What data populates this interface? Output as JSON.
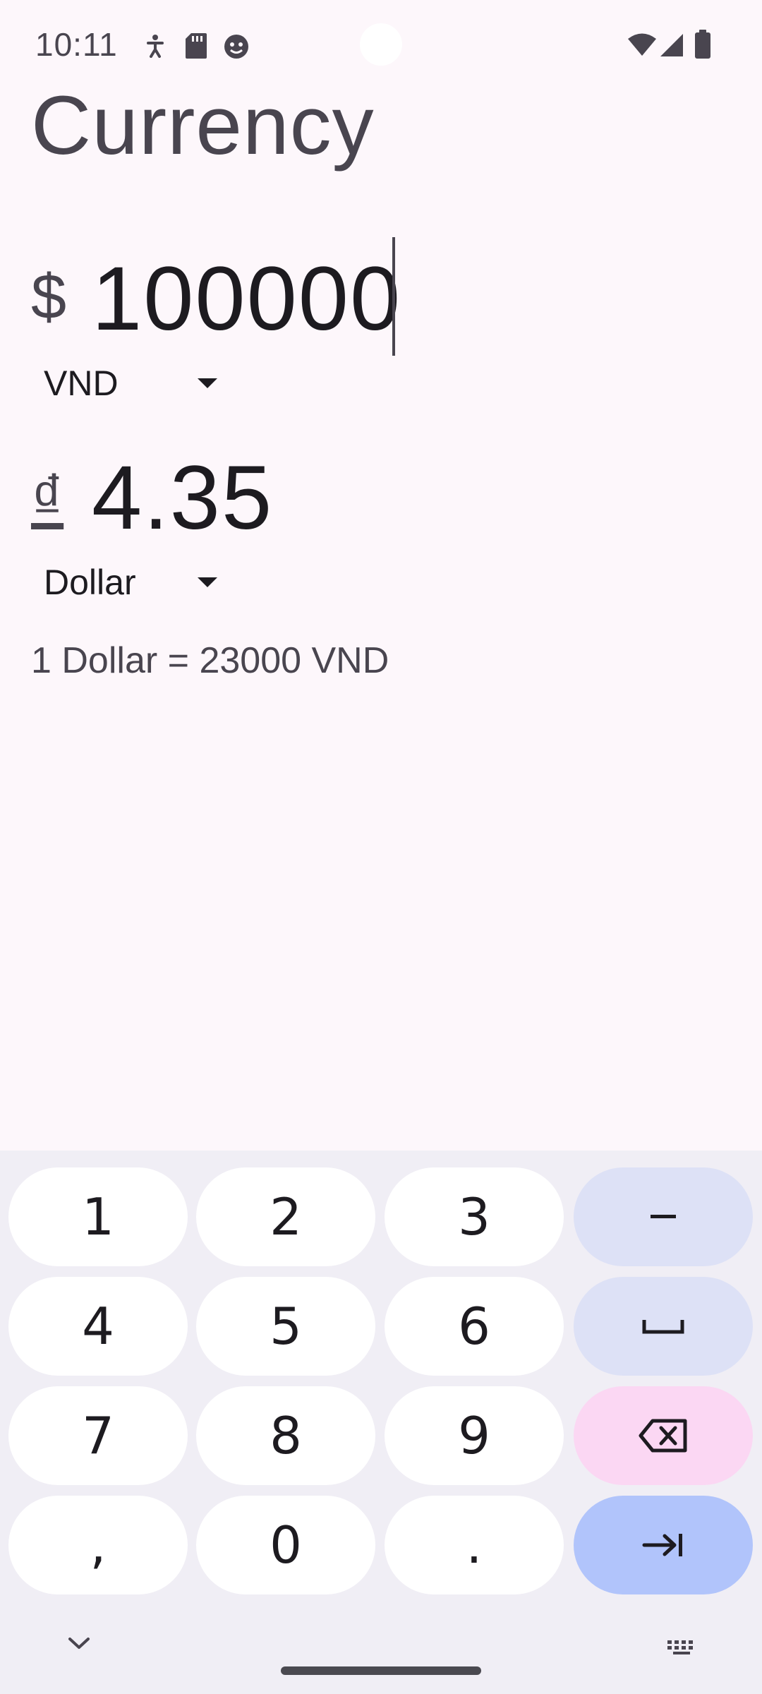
{
  "status_bar": {
    "time": "10:11",
    "left_icons": [
      "accessibility-icon",
      "sd-card-icon",
      "face-icon"
    ],
    "right_icons": [
      "wifi-icon",
      "signal-icon",
      "battery-icon"
    ]
  },
  "app": {
    "title": "Currency",
    "from": {
      "symbol": "$",
      "amount": "100000",
      "currency": "VND"
    },
    "to": {
      "symbol": "₫",
      "amount": "4.35",
      "currency": "Dollar"
    },
    "rate_text": "1 Dollar = 23000 VND"
  },
  "keyboard": {
    "keys": [
      "1",
      "2",
      "3",
      "–",
      "4",
      "5",
      "6",
      "␣",
      "7",
      "8",
      "9",
      "⌫",
      ",",
      "0",
      ".",
      "⇥"
    ],
    "icons": [
      "minus-icon",
      "space-icon",
      "backspace-icon",
      "tab-next-icon"
    ]
  },
  "colors": {
    "background": "#fdf7fb",
    "keyboard_bg": "#f0eef5",
    "key_bg": "#ffffff",
    "func_key_bg": "#dde1f6",
    "delete_key_bg": "#fbd7f3",
    "enter_key_bg": "#b1c4fb",
    "text_primary": "#1d1b20",
    "text_secondary": "#49454f"
  }
}
